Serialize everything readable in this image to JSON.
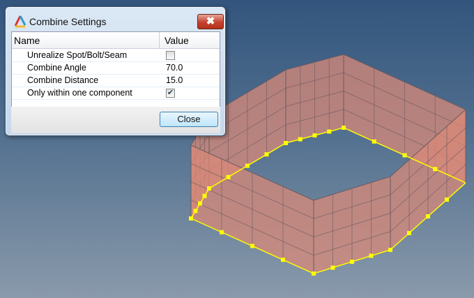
{
  "dialog": {
    "title": "Combine Settings",
    "close_label": "Close",
    "columns": {
      "name": "Name",
      "value": "Value"
    },
    "rows": [
      {
        "name": "Unrealize Spot/Bolt/Seam",
        "type": "checkbox",
        "checked": false
      },
      {
        "name": "Combine Angle",
        "value": "70.0"
      },
      {
        "name": "Combine Distance",
        "value": "15.0"
      },
      {
        "name": "Only within one component",
        "type": "checkbox",
        "checked": true
      }
    ]
  },
  "icons": {
    "check": "✔",
    "close": "✖"
  },
  "colors": {
    "wall": "#d98a78",
    "edge": "#ffff00"
  }
}
